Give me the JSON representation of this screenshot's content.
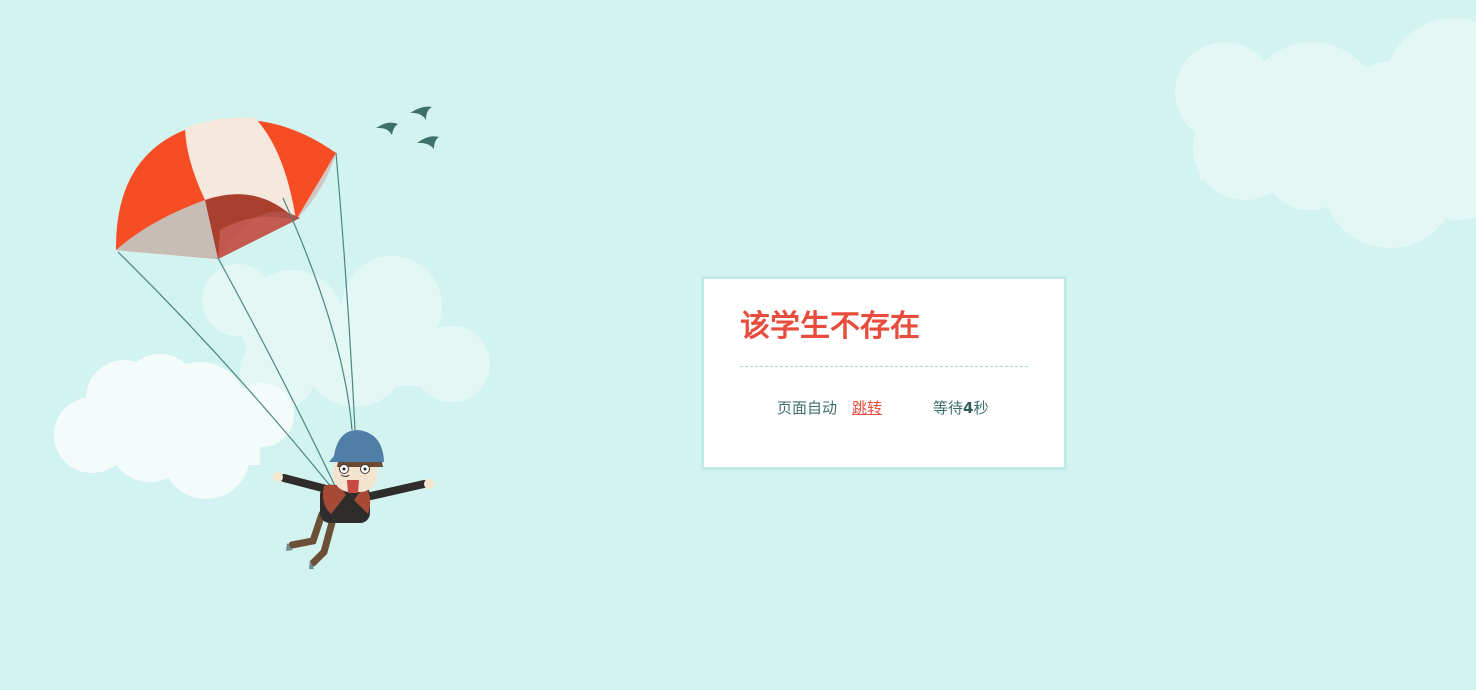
{
  "message": {
    "title": "该学生不存在",
    "redirect_label": "页面自动",
    "redirect_link": "跳转",
    "wait_prefix": "等待",
    "wait_seconds": "4",
    "wait_suffix": "秒"
  },
  "colors": {
    "background": "#d2f3ef",
    "title": "#e84c3d",
    "link": "#e84c3d",
    "text": "#3d6f69",
    "box_border": "#bfeae5"
  },
  "illustration": {
    "icons": [
      "cloud-icon",
      "parachute-icon",
      "skydiver-icon",
      "bird-icon"
    ]
  }
}
